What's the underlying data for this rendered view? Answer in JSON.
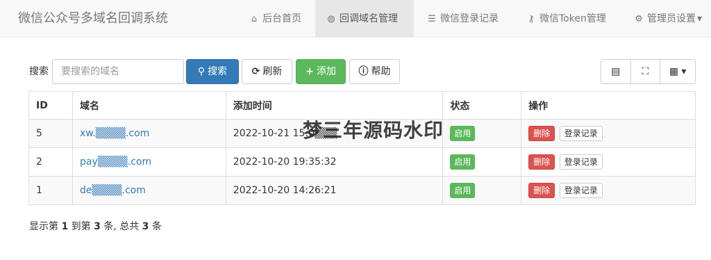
{
  "nav": {
    "brand": "微信公众号多域名回调系统",
    "items": [
      {
        "label": "后台首页",
        "icon": "home-icon",
        "glyph": "⌂"
      },
      {
        "label": "回调域名管理",
        "icon": "globe-icon",
        "glyph": "◍"
      },
      {
        "label": "微信登录记录",
        "icon": "list-icon",
        "glyph": "☰"
      },
      {
        "label": "微信Token管理",
        "icon": "key-icon",
        "glyph": "⚷"
      },
      {
        "label": "管理员设置",
        "icon": "gear-icon",
        "glyph": "⚙",
        "caret": "▾"
      }
    ]
  },
  "toolbar": {
    "search_label": "搜索",
    "search_placeholder": "要搜索的域名",
    "search_button": "搜索",
    "refresh_button": "刷新",
    "add_button": "添加",
    "help_button": "帮助",
    "search_glyph": "⚲",
    "refresh_glyph": "⟳",
    "add_glyph": "+",
    "help_glyph": "ⓘ",
    "view_list_glyph": "▤",
    "fullscreen_glyph": "⛶",
    "columns_glyph": "▦ ▾"
  },
  "table": {
    "headers": [
      "ID",
      "域名",
      "添加时间",
      "状态",
      "操作"
    ],
    "rows": [
      {
        "id": "5",
        "domain": "xw.▒▒▒▒.com",
        "time": "2022-10-21 15:0▒▒▒",
        "status": "启用",
        "delete": "删除",
        "log": "登录记录"
      },
      {
        "id": "2",
        "domain": "pay▒▒▒▒.com",
        "time": "2022-10-20 19:35:32",
        "status": "启用",
        "delete": "删除",
        "log": "登录记录"
      },
      {
        "id": "1",
        "domain": "de▒▒▒▒.com",
        "time": "2022-10-20 14:26:21",
        "status": "启用",
        "delete": "删除",
        "log": "登录记录"
      }
    ]
  },
  "watermark": "梦三年源码水印",
  "pagination": {
    "prefix": "显示第",
    "from": "1",
    "mid": "到第",
    "to": "3",
    "mid2": "条, 总共",
    "total": "3",
    "suffix": "条"
  },
  "colors": {
    "primary": "#337ab7",
    "success": "#5cb85c",
    "danger": "#d9534f"
  }
}
